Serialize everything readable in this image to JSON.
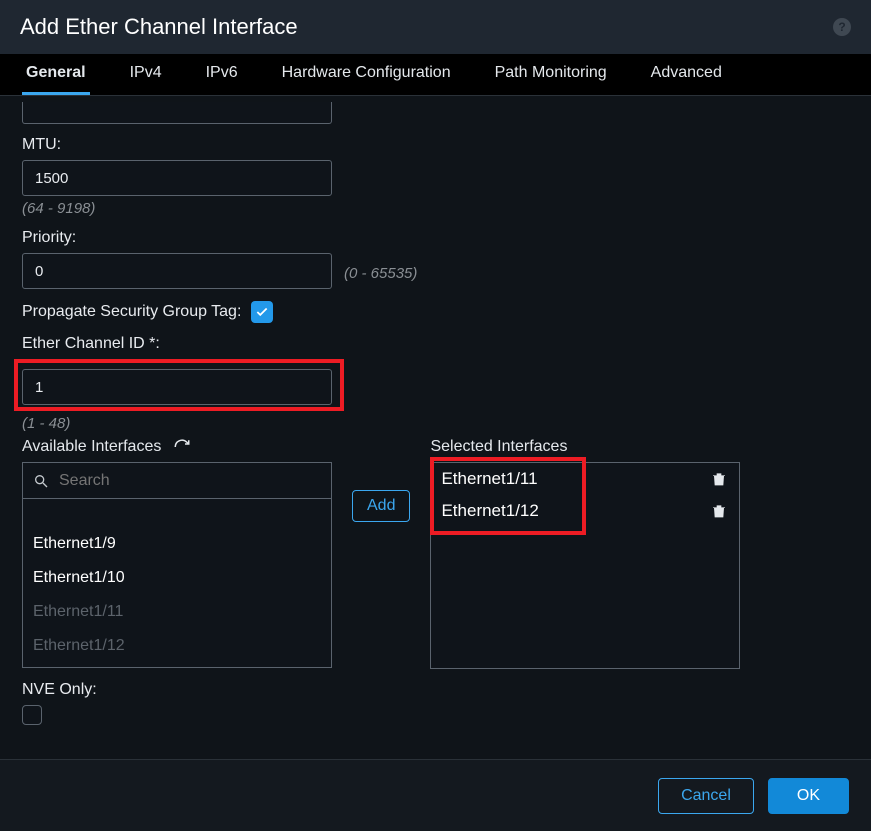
{
  "title": "Add Ether Channel Interface",
  "tabs": [
    "General",
    "IPv4",
    "IPv6",
    "Hardware Configuration",
    "Path Monitoring",
    "Advanced"
  ],
  "mtu": {
    "label": "MTU:",
    "value": "1500",
    "hint": "(64 - 9198)"
  },
  "priority": {
    "label": "Priority:",
    "value": "0",
    "hint": "(0 - 65535)"
  },
  "propagate": {
    "label": "Propagate Security Group Tag:",
    "checked": true
  },
  "echannel": {
    "label": "Ether Channel ID *:",
    "value": "1",
    "hint": "(1 - 48)"
  },
  "available": {
    "label": "Available Interfaces",
    "search_placeholder": "Search",
    "items": [
      {
        "name": "Ethernet1/9",
        "disabled": false
      },
      {
        "name": "Ethernet1/10",
        "disabled": false
      },
      {
        "name": "Ethernet1/11",
        "disabled": true
      },
      {
        "name": "Ethernet1/12",
        "disabled": true
      }
    ]
  },
  "add_label": "Add",
  "selected": {
    "label": "Selected Interfaces",
    "items": [
      "Ethernet1/11",
      "Ethernet1/12"
    ]
  },
  "nve": {
    "label": "NVE Only:",
    "checked": false
  },
  "footer": {
    "cancel": "Cancel",
    "ok": "OK"
  }
}
